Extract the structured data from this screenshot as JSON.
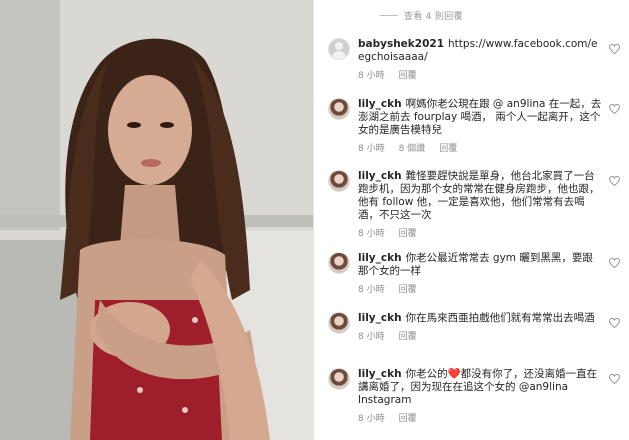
{
  "view_replies": "查看 4 則回覆",
  "comments": [
    {
      "username": "babyshek2021",
      "text": "https://www.facebook.com/eegchoisaaaa/",
      "time": "8 小時",
      "likes": "",
      "reply": "回覆"
    },
    {
      "username": "lily_ckh",
      "text": "啊媽你老公現在跟 @ an9lina 在一起，去澎湖之前去 fourplay 喝酒， 兩个人一起离开，这个女的是廣告模特兒",
      "time": "8 小時",
      "likes": "8 個讚",
      "reply": "回覆"
    },
    {
      "username": "lily_ckh",
      "text": "難怪要趕快說是單身，他台北家買了一台跑步机，因为那个女的常常在健身房跑步，他也跟，他有 follow 他，一定是喜欢他，他们常常有去喝酒，不只这一次",
      "time": "8 小時",
      "likes": "",
      "reply": "回覆"
    },
    {
      "username": "lily_ckh",
      "text": "你老公最近常常去 gym 曬到黑黑，要跟那个女的一样",
      "time": "8 小時",
      "likes": "",
      "reply": "回覆"
    },
    {
      "username": "lily_ckh",
      "text": "你在馬來西亜拍戲他们就有常常出去喝酒",
      "time": "8 小時",
      "likes": "",
      "reply": "回覆"
    },
    {
      "username": "lily_ckh",
      "text_before": "你老公的",
      "emoji": "❤️",
      "text_after": "都没有你了，还没离婚一直在講离婚了，因为现在在追这个女的 @an9lina Instagram",
      "time": "8 小時",
      "likes": "",
      "reply": "回覆"
    }
  ],
  "icons": {
    "like": "heart-outline-icon",
    "avatar_default": "default-avatar-icon"
  },
  "colors": {
    "text": "#262626",
    "meta": "#8e8e8e",
    "heart": "#e0243a"
  }
}
